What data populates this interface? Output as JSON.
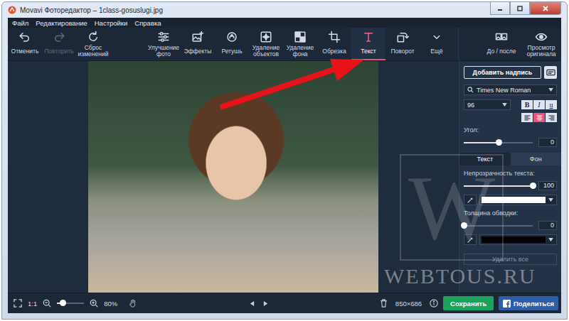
{
  "window": {
    "title": "Movavi Фоторедактор – 1class-gosuslugi.jpg"
  },
  "menu": [
    {
      "label": "Файл"
    },
    {
      "label": "Редактирование"
    },
    {
      "label": "Настройки"
    },
    {
      "label": "Справка"
    }
  ],
  "history": [
    {
      "label": "Отменить",
      "disabled": false
    },
    {
      "label": "Повторить",
      "disabled": true
    },
    {
      "label": "Сброс изменений",
      "disabled": false
    }
  ],
  "tools": [
    {
      "label": "Улучшение фото",
      "selected": false
    },
    {
      "label": "Эффекты",
      "selected": false
    },
    {
      "label": "Ретушь",
      "selected": false
    },
    {
      "label": "Удаление объектов",
      "selected": false
    },
    {
      "label": "Удаление фона",
      "selected": false
    },
    {
      "label": "Обрезка",
      "selected": false
    },
    {
      "label": "Текст",
      "selected": true
    },
    {
      "label": "Поворот",
      "selected": false
    },
    {
      "label": "Ещё",
      "selected": false
    }
  ],
  "view_buttons": [
    {
      "label": "До / после"
    },
    {
      "label": "Просмотр оригинала"
    }
  ],
  "text_panel": {
    "add_button": "Добавить надпись",
    "font": "Times New Roman",
    "size": "96",
    "styles": [
      {
        "label": "B",
        "kind": "bold",
        "selected": false
      },
      {
        "label": "I",
        "kind": "italic",
        "selected": false
      },
      {
        "label": "u",
        "kind": "underline",
        "selected": false
      }
    ],
    "align": [
      {
        "kind": "left",
        "selected": false
      },
      {
        "kind": "center",
        "selected": true
      },
      {
        "kind": "right",
        "selected": false
      }
    ],
    "angle": {
      "label": "Угол:",
      "level": 0.5,
      "value": "0"
    },
    "tabs": [
      {
        "label": "Текст",
        "selected": true
      },
      {
        "label": "Фон",
        "selected": false
      }
    ],
    "opacity": {
      "label": "Непрозрачность текста:",
      "level": 1,
      "value": "100"
    },
    "text_color": "#ffffff",
    "stroke": {
      "label": "Толщина обводки:",
      "level": 0,
      "value": "0"
    },
    "stroke_color": "#000000",
    "delete_all": {
      "label": "Удалить все",
      "disabled": true
    }
  },
  "bottom_bar": {
    "fit_label": "1:1",
    "zoom": {
      "level": 0.2,
      "value": "80%"
    },
    "size": "850×686",
    "save": "Сохранить",
    "share": "Поделиться"
  },
  "watermark": {
    "letter": "W",
    "site": "WEBTOUS.RU"
  }
}
